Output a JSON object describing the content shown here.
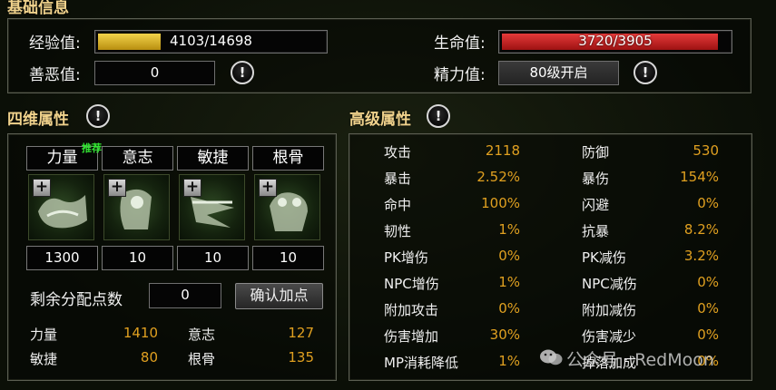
{
  "basic": {
    "title": "基础信息",
    "exp_label": "经验值:",
    "exp_value": "4103/14698",
    "exp_fraction": 0.279,
    "karma_label": "善恶值:",
    "karma_value": "0",
    "hp_label": "生命值:",
    "hp_value": "3720/3905",
    "hp_fraction": 0.953,
    "energy_label": "精力值:",
    "energy_value": "80级开启",
    "info_icon": "!"
  },
  "four": {
    "title": "四维属性",
    "recommend_badge": "推荐",
    "stats": [
      {
        "name": "力量",
        "value": "1300"
      },
      {
        "name": "意志",
        "value": "10"
      },
      {
        "name": "敏捷",
        "value": "10"
      },
      {
        "name": "根骨",
        "value": "10"
      }
    ],
    "plus": "+",
    "remaining_label": "剩余分配点数",
    "remaining_value": "0",
    "confirm_label": "确认加点",
    "totals": [
      {
        "name": "力量",
        "value": "1410"
      },
      {
        "name": "意志",
        "value": "127"
      },
      {
        "name": "敏捷",
        "value": "80"
      },
      {
        "name": "根骨",
        "value": "135"
      }
    ]
  },
  "advanced": {
    "title": "高级属性",
    "left": [
      {
        "name": "攻击",
        "value": "2118"
      },
      {
        "name": "暴击",
        "value": "2.52%"
      },
      {
        "name": "命中",
        "value": "100%"
      },
      {
        "name": "韧性",
        "value": "1%"
      },
      {
        "name": "PK增伤",
        "value": "0%"
      },
      {
        "name": "NPC增伤",
        "value": "1%"
      },
      {
        "name": "附加攻击",
        "value": "0%"
      },
      {
        "name": "伤害增加",
        "value": "30%"
      },
      {
        "name": "MP消耗降低",
        "value": "1%"
      }
    ],
    "right": [
      {
        "name": "防御",
        "value": "530"
      },
      {
        "name": "暴伤",
        "value": "154%"
      },
      {
        "name": "闪避",
        "value": "0%"
      },
      {
        "name": "抗暴",
        "value": "8.2%"
      },
      {
        "name": "PK减伤",
        "value": "3.2%"
      },
      {
        "name": "NPC减伤",
        "value": "0%"
      },
      {
        "name": "附加减伤",
        "value": "0%"
      },
      {
        "name": "伤害减少",
        "value": "0%"
      },
      {
        "name": "掉落加成",
        "value": "0%"
      }
    ]
  },
  "watermark": "公众号 · RedMoon",
  "colors": {
    "exp_bar": "#d9b421",
    "hp_bar": "#c81e1e",
    "value": "#e0a020",
    "title": "#f0d28c"
  }
}
